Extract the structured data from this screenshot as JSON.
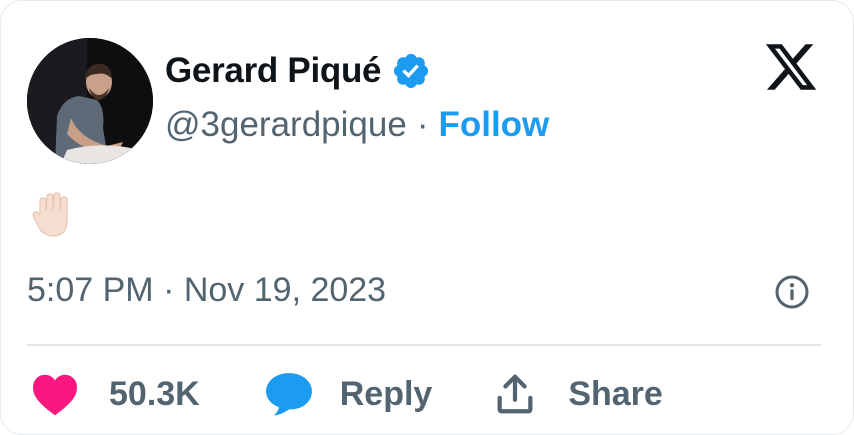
{
  "tweet": {
    "display_name": "Gerard Piqué",
    "handle": "@3gerardpique",
    "separator": "·",
    "follow_label": "Follow",
    "text": "✋🏻",
    "timestamp": "5:07 PM · Nov 19, 2023",
    "verified_icon": "verified-badge-icon",
    "brand_logo": "x-logo-icon"
  },
  "actions": {
    "like_count": "50.3K",
    "reply_label": "Reply",
    "share_label": "Share"
  },
  "colors": {
    "accent": "#1d9bf0",
    "like": "#f91880",
    "secondary_text": "#536471",
    "primary_text": "#0f1419"
  }
}
